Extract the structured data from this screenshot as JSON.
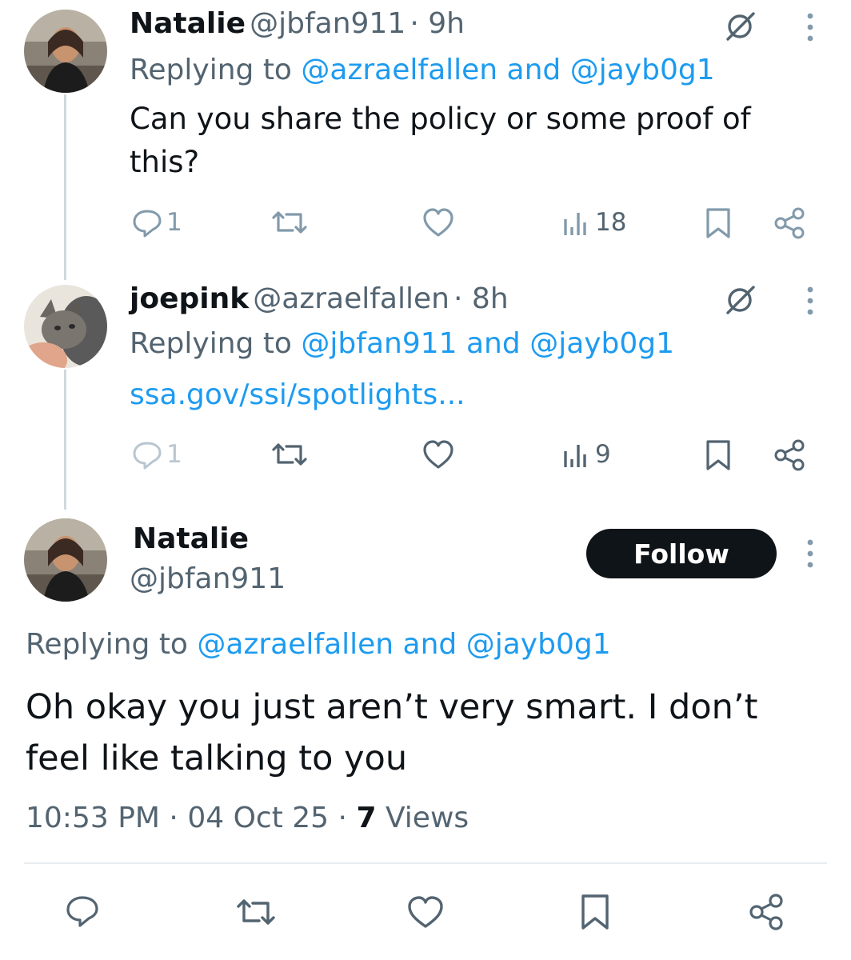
{
  "tweets": [
    {
      "name": "Natalie",
      "handle": "@jbfan911",
      "time": "· 9h",
      "replying_label": "Replying to",
      "reply_user_1": "@azraelfallen",
      "reply_and": "and",
      "reply_user_2": "@jayb0g1",
      "text_line1": "Can you share the policy or some proof of",
      "text_line2": "this?",
      "reply_count": "1",
      "views_count": "18"
    },
    {
      "name": "joepink",
      "handle": "@azraelfallen",
      "time": "· 8h",
      "replying_label": "Replying to",
      "reply_user_1": "@jbfan911",
      "reply_and": "and",
      "reply_user_2": "@jayb0g1",
      "link": "ssa.gov/ssi/spotlights...",
      "reply_count": "1",
      "views_count": "9"
    }
  ],
  "focus": {
    "name": "Natalie",
    "handle": "@jbfan911",
    "follow_label": "Follow",
    "replying_label": "Replying to",
    "reply_user_1": "@azraelfallen",
    "reply_and": "and",
    "reply_user_2": "@jayb0g1",
    "text_line1": "Oh okay you just aren’t very smart. I don’t",
    "text_line2": "feel like talking to you",
    "time": "10:53 PM",
    "date": "04 Oct 25",
    "views_count": "7",
    "views_label": "Views"
  },
  "colors": {
    "accent": "#1d9bf0",
    "text": "#0f1419",
    "secondary": "#536471",
    "button_bg": "#0f1419"
  }
}
